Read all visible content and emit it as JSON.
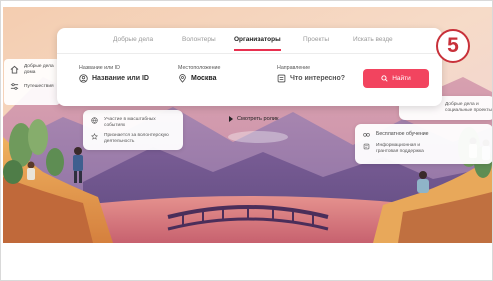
{
  "tabs": [
    {
      "label": "Добрые дела",
      "active": false
    },
    {
      "label": "Волонтеры",
      "active": false
    },
    {
      "label": "Организаторы",
      "active": true
    },
    {
      "label": "Проекты",
      "active": false
    },
    {
      "label": "Искать везде",
      "active": false
    }
  ],
  "search": {
    "name": {
      "label": "Название или ID",
      "value": "Название или ID",
      "icon": "user-circle-icon"
    },
    "location": {
      "label": "Местоположение",
      "value": "Москва",
      "icon": "map-pin-icon"
    },
    "direction": {
      "label": "Направление",
      "value": "Что интересно?",
      "icon": "list-icon"
    },
    "button": {
      "label": "Найти",
      "icon": "search-icon"
    }
  },
  "badge": {
    "text": "5"
  },
  "left_panel": {
    "items": [
      {
        "icon": "home-icon",
        "label": "Добрые дела дома"
      },
      {
        "icon": "sliders-icon",
        "label": "Путешествия"
      }
    ]
  },
  "info_left": {
    "items": [
      {
        "icon": "globe-icon",
        "label": "Участие в масштабных событиях"
      },
      {
        "icon": "star-icon",
        "label": "Признается за волонтерскую деятельность"
      }
    ]
  },
  "info_right_top": {
    "items": [
      {
        "label": "Добрые дела и социальные проекты"
      }
    ]
  },
  "info_right": {
    "items": [
      {
        "icon": "glasses-icon",
        "label": "Бесплатное обучение"
      },
      {
        "icon": "doc-icon",
        "label": "Информационная и грантовая поддержка"
      }
    ]
  },
  "video": {
    "label": "Смотреть ролик"
  },
  "colors": {
    "accent": "#f2445f",
    "badge": "#c8313a"
  }
}
